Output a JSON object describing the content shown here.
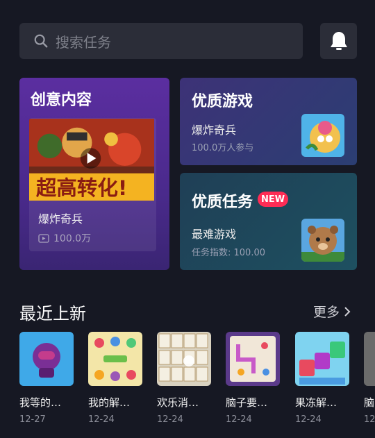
{
  "search": {
    "placeholder": "搜索任务",
    "icon": "search-icon"
  },
  "header": {
    "bell_icon": "bell-icon"
  },
  "creative": {
    "title": "创意内容",
    "banner_text": "超高转化!",
    "game_name": "爆炸奇兵",
    "views": "100.0万"
  },
  "quality_game": {
    "title": "优质游戏",
    "game_name": "爆炸奇兵",
    "participants": "100.0万人参与"
  },
  "quality_task": {
    "title": "优质任务",
    "badge": "NEW",
    "game_name": "最难游戏",
    "index_text": "任务指数: 100.00"
  },
  "recent": {
    "title": "最近上新",
    "more_label": "更多",
    "items": [
      {
        "name": "我等的…",
        "date": "12-27"
      },
      {
        "name": "我的解…",
        "date": "12-24"
      },
      {
        "name": "欢乐消…",
        "date": "12-24"
      },
      {
        "name": "脑子要…",
        "date": "12-24"
      },
      {
        "name": "果冻解…",
        "date": "12-24"
      },
      {
        "name": "脑",
        "date": "12"
      }
    ]
  },
  "colors": {
    "background": "#161823",
    "accent_badge": "#fe2c55"
  }
}
